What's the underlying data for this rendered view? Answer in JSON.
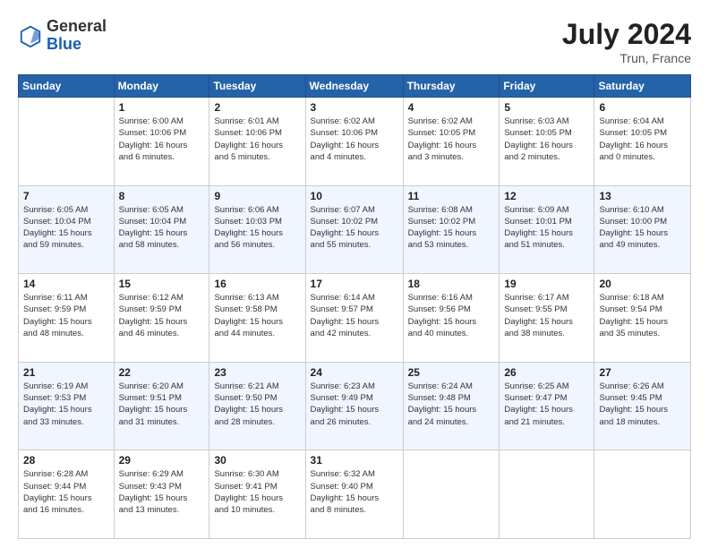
{
  "header": {
    "logo_general": "General",
    "logo_blue": "Blue",
    "month_year": "July 2024",
    "location": "Trun, France"
  },
  "days_of_week": [
    "Sunday",
    "Monday",
    "Tuesday",
    "Wednesday",
    "Thursday",
    "Friday",
    "Saturday"
  ],
  "weeks": [
    [
      {
        "day": "",
        "info": ""
      },
      {
        "day": "1",
        "info": "Sunrise: 6:00 AM\nSunset: 10:06 PM\nDaylight: 16 hours\nand 6 minutes."
      },
      {
        "day": "2",
        "info": "Sunrise: 6:01 AM\nSunset: 10:06 PM\nDaylight: 16 hours\nand 5 minutes."
      },
      {
        "day": "3",
        "info": "Sunrise: 6:02 AM\nSunset: 10:06 PM\nDaylight: 16 hours\nand 4 minutes."
      },
      {
        "day": "4",
        "info": "Sunrise: 6:02 AM\nSunset: 10:05 PM\nDaylight: 16 hours\nand 3 minutes."
      },
      {
        "day": "5",
        "info": "Sunrise: 6:03 AM\nSunset: 10:05 PM\nDaylight: 16 hours\nand 2 minutes."
      },
      {
        "day": "6",
        "info": "Sunrise: 6:04 AM\nSunset: 10:05 PM\nDaylight: 16 hours\nand 0 minutes."
      }
    ],
    [
      {
        "day": "7",
        "info": "Sunrise: 6:05 AM\nSunset: 10:04 PM\nDaylight: 15 hours\nand 59 minutes."
      },
      {
        "day": "8",
        "info": "Sunrise: 6:05 AM\nSunset: 10:04 PM\nDaylight: 15 hours\nand 58 minutes."
      },
      {
        "day": "9",
        "info": "Sunrise: 6:06 AM\nSunset: 10:03 PM\nDaylight: 15 hours\nand 56 minutes."
      },
      {
        "day": "10",
        "info": "Sunrise: 6:07 AM\nSunset: 10:02 PM\nDaylight: 15 hours\nand 55 minutes."
      },
      {
        "day": "11",
        "info": "Sunrise: 6:08 AM\nSunset: 10:02 PM\nDaylight: 15 hours\nand 53 minutes."
      },
      {
        "day": "12",
        "info": "Sunrise: 6:09 AM\nSunset: 10:01 PM\nDaylight: 15 hours\nand 51 minutes."
      },
      {
        "day": "13",
        "info": "Sunrise: 6:10 AM\nSunset: 10:00 PM\nDaylight: 15 hours\nand 49 minutes."
      }
    ],
    [
      {
        "day": "14",
        "info": "Sunrise: 6:11 AM\nSunset: 9:59 PM\nDaylight: 15 hours\nand 48 minutes."
      },
      {
        "day": "15",
        "info": "Sunrise: 6:12 AM\nSunset: 9:59 PM\nDaylight: 15 hours\nand 46 minutes."
      },
      {
        "day": "16",
        "info": "Sunrise: 6:13 AM\nSunset: 9:58 PM\nDaylight: 15 hours\nand 44 minutes."
      },
      {
        "day": "17",
        "info": "Sunrise: 6:14 AM\nSunset: 9:57 PM\nDaylight: 15 hours\nand 42 minutes."
      },
      {
        "day": "18",
        "info": "Sunrise: 6:16 AM\nSunset: 9:56 PM\nDaylight: 15 hours\nand 40 minutes."
      },
      {
        "day": "19",
        "info": "Sunrise: 6:17 AM\nSunset: 9:55 PM\nDaylight: 15 hours\nand 38 minutes."
      },
      {
        "day": "20",
        "info": "Sunrise: 6:18 AM\nSunset: 9:54 PM\nDaylight: 15 hours\nand 35 minutes."
      }
    ],
    [
      {
        "day": "21",
        "info": "Sunrise: 6:19 AM\nSunset: 9:53 PM\nDaylight: 15 hours\nand 33 minutes."
      },
      {
        "day": "22",
        "info": "Sunrise: 6:20 AM\nSunset: 9:51 PM\nDaylight: 15 hours\nand 31 minutes."
      },
      {
        "day": "23",
        "info": "Sunrise: 6:21 AM\nSunset: 9:50 PM\nDaylight: 15 hours\nand 28 minutes."
      },
      {
        "day": "24",
        "info": "Sunrise: 6:23 AM\nSunset: 9:49 PM\nDaylight: 15 hours\nand 26 minutes."
      },
      {
        "day": "25",
        "info": "Sunrise: 6:24 AM\nSunset: 9:48 PM\nDaylight: 15 hours\nand 24 minutes."
      },
      {
        "day": "26",
        "info": "Sunrise: 6:25 AM\nSunset: 9:47 PM\nDaylight: 15 hours\nand 21 minutes."
      },
      {
        "day": "27",
        "info": "Sunrise: 6:26 AM\nSunset: 9:45 PM\nDaylight: 15 hours\nand 18 minutes."
      }
    ],
    [
      {
        "day": "28",
        "info": "Sunrise: 6:28 AM\nSunset: 9:44 PM\nDaylight: 15 hours\nand 16 minutes."
      },
      {
        "day": "29",
        "info": "Sunrise: 6:29 AM\nSunset: 9:43 PM\nDaylight: 15 hours\nand 13 minutes."
      },
      {
        "day": "30",
        "info": "Sunrise: 6:30 AM\nSunset: 9:41 PM\nDaylight: 15 hours\nand 10 minutes."
      },
      {
        "day": "31",
        "info": "Sunrise: 6:32 AM\nSunset: 9:40 PM\nDaylight: 15 hours\nand 8 minutes."
      },
      {
        "day": "",
        "info": ""
      },
      {
        "day": "",
        "info": ""
      },
      {
        "day": "",
        "info": ""
      }
    ]
  ]
}
